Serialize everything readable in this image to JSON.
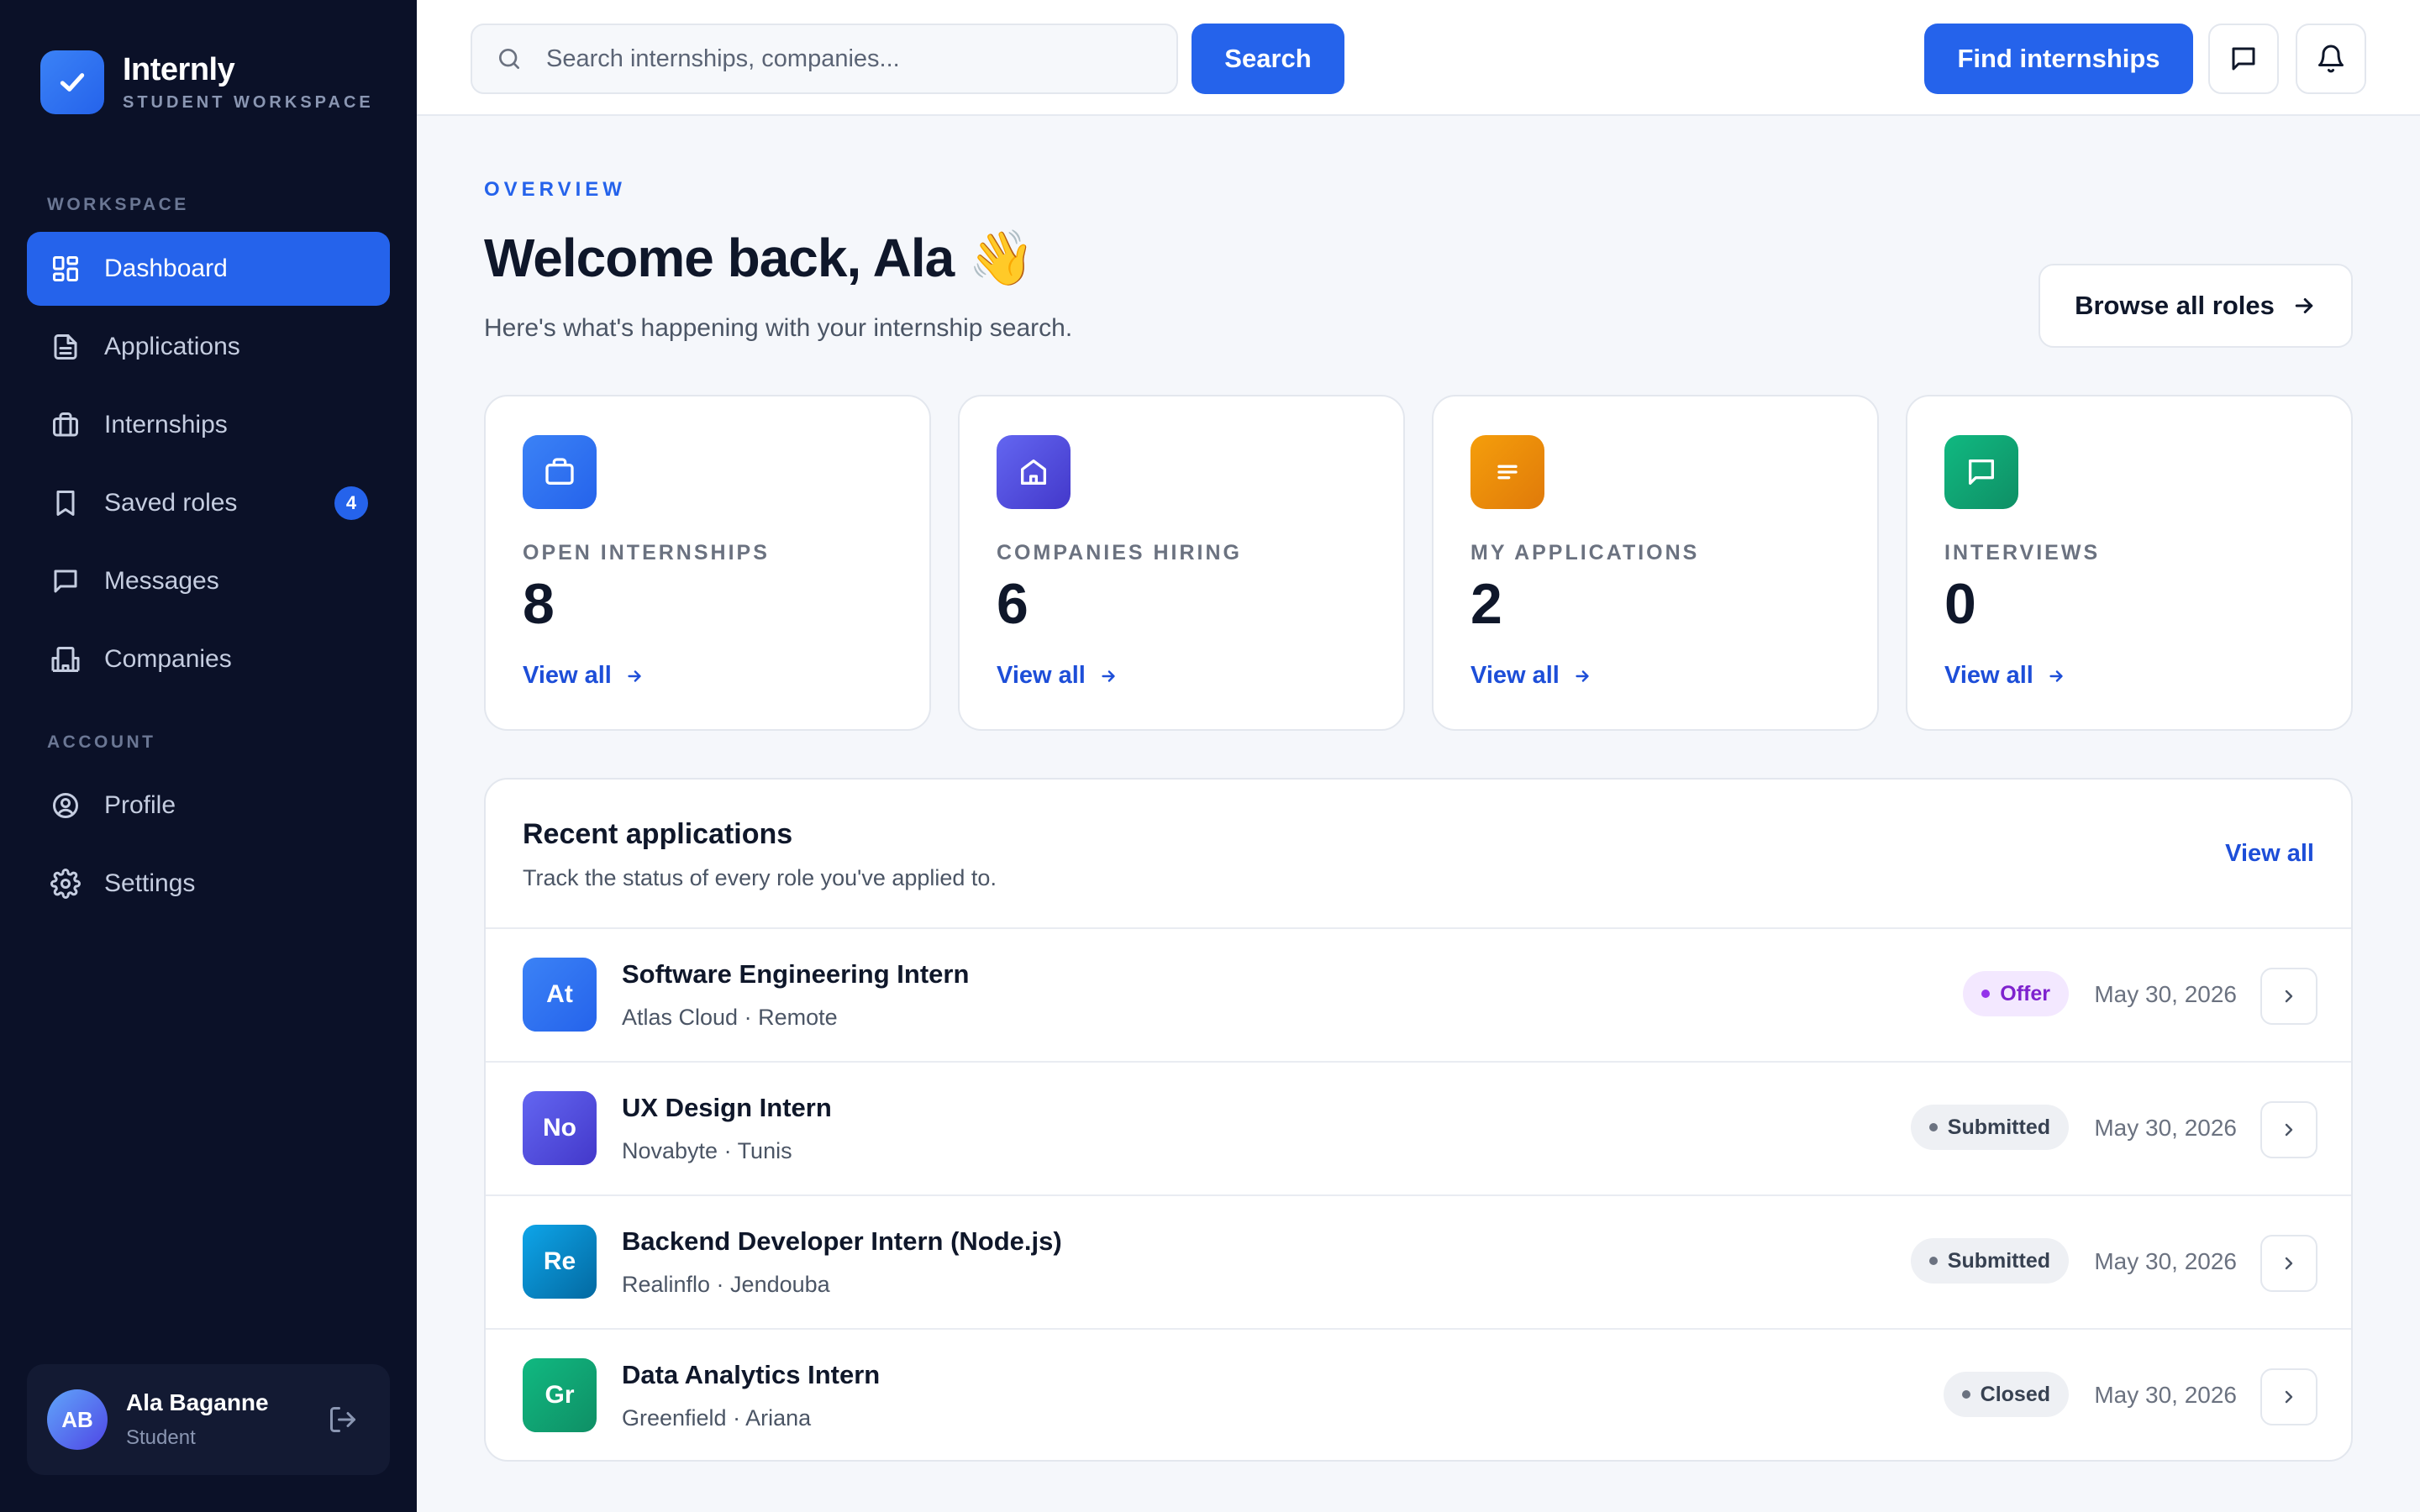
{
  "brand": {
    "name": "Internly",
    "subtitle": "STUDENT WORKSPACE"
  },
  "sidebar": {
    "sections": [
      {
        "label": "WORKSPACE"
      },
      {
        "label": "ACCOUNT"
      }
    ],
    "items": [
      {
        "label": "Dashboard",
        "icon": "dashboard-icon",
        "active": true
      },
      {
        "label": "Applications",
        "icon": "document-icon"
      },
      {
        "label": "Internships",
        "icon": "briefcase-icon"
      },
      {
        "label": "Saved roles",
        "icon": "bookmark-icon",
        "badge": "4"
      },
      {
        "label": "Messages",
        "icon": "message-icon"
      },
      {
        "label": "Companies",
        "icon": "building-icon"
      },
      {
        "label": "Profile",
        "icon": "user-circle-icon"
      },
      {
        "label": "Settings",
        "icon": "gear-icon"
      }
    ],
    "user": {
      "initials": "AB",
      "name": "Ala Baganne",
      "role": "Student"
    }
  },
  "topbar": {
    "search_placeholder": "Search internships, companies...",
    "search_button": "Search",
    "find_button": "Find internships"
  },
  "header": {
    "overline": "OVERVIEW",
    "title": "Welcome back, Ala 👋",
    "subtitle": "Here's what's happening with your internship search.",
    "browse_button": "Browse all roles"
  },
  "stats": [
    {
      "label": "OPEN INTERNSHIPS",
      "value": "8",
      "link": "View all",
      "icon": "briefcase-icon",
      "color": "#2563eb"
    },
    {
      "label": "COMPANIES HIRING",
      "value": "6",
      "link": "View all",
      "icon": "home-icon",
      "color": "#4f46e5"
    },
    {
      "label": "MY APPLICATIONS",
      "value": "2",
      "link": "View all",
      "icon": "list-icon",
      "color": "#ea8a0b"
    },
    {
      "label": "INTERVIEWS",
      "value": "0",
      "link": "View all",
      "icon": "chat-icon",
      "color": "#16a070"
    }
  ],
  "recent": {
    "title": "Recent applications",
    "subtitle": "Track the status of every role you've applied to.",
    "view_all": "View all",
    "rows": [
      {
        "initials": "At",
        "title": "Software Engineering Intern",
        "meta": "Atlas Cloud · Remote",
        "status": "Offer",
        "date": "May 30, 2026",
        "color": "#2563eb"
      },
      {
        "initials": "No",
        "title": "UX Design Intern",
        "meta": "Novabyte · Tunis",
        "status": "Submitted",
        "date": "May 30, 2026",
        "color": "#4f46e5"
      },
      {
        "initials": "Re",
        "title": "Backend Developer Intern (Node.js)",
        "meta": "Realinflo · Jendouba",
        "status": "Submitted",
        "date": "May 30, 2026",
        "color": "#0284c7"
      },
      {
        "initials": "Gr",
        "title": "Data Analytics Intern",
        "meta": "Greenfield · Ariana",
        "status": "Closed",
        "date": "May 30, 2026",
        "color": "#16a070"
      }
    ]
  }
}
